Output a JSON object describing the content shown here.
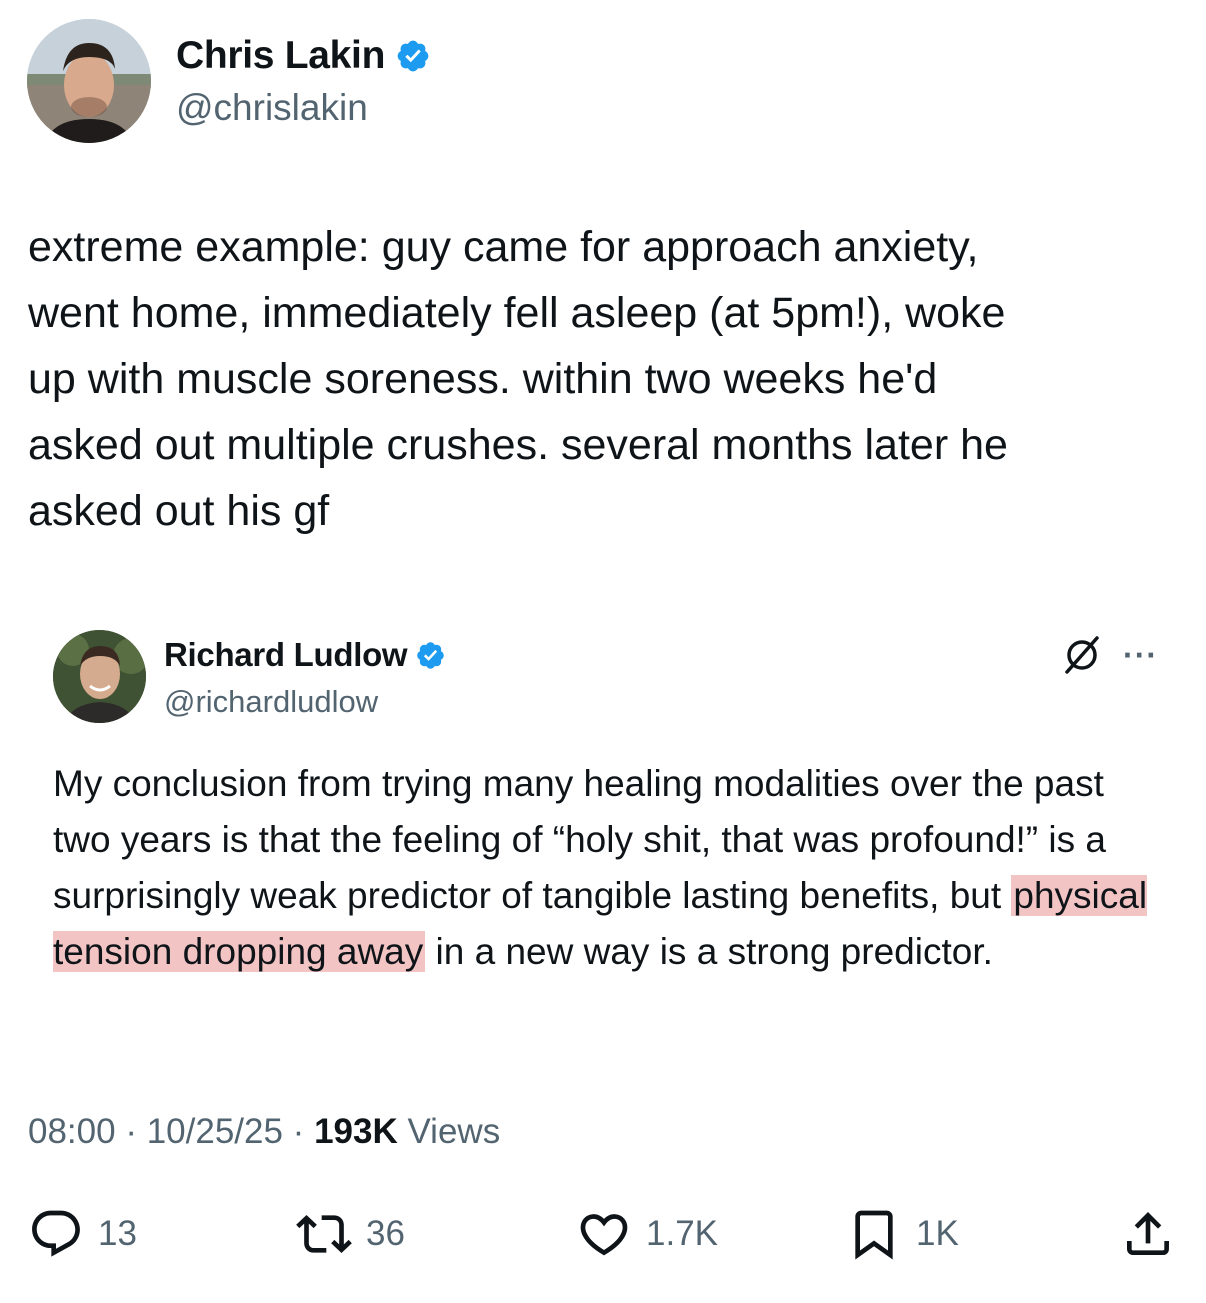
{
  "author": {
    "name": "Chris Lakin",
    "handle": "@chrislakin",
    "verified": true
  },
  "tweet": {
    "text": "extreme example: guy came for approach anxiety,\nwent home, immediately fell asleep (at 5pm!), woke\nup with muscle soreness. within two weeks he'd\nasked out multiple crushes. several months later he\nasked out his gf"
  },
  "quote": {
    "name": "Richard Ludlow",
    "handle": "@richardludlow",
    "verified": true,
    "text_before": "My conclusion from trying many healing modalities over the past two years is that the feeling of “holy shit, that was profound!” is a surprisingly weak predictor of tangible lasting benefits, but ",
    "text_highlight": "physical tension dropping away",
    "text_after": " in a new way is a strong predictor.",
    "tools_icon": "grok-slash-icon",
    "more_label": "···"
  },
  "meta": {
    "time": "08:00",
    "date": "10/25/25",
    "sep": " · ",
    "views_count": "193K",
    "views_label": "Views"
  },
  "actions": {
    "reply": {
      "icon": "reply-icon",
      "count": "13"
    },
    "repost": {
      "icon": "repost-icon",
      "count": "36"
    },
    "like": {
      "icon": "heart-icon",
      "count": "1.7K"
    },
    "bookmark": {
      "icon": "bookmark-icon",
      "count": "1K"
    },
    "share": {
      "icon": "share-icon"
    }
  },
  "colors": {
    "text": "#0f1419",
    "secondary": "#536471",
    "verified": "#1d9bf0",
    "highlight": "#f2c4c4"
  }
}
